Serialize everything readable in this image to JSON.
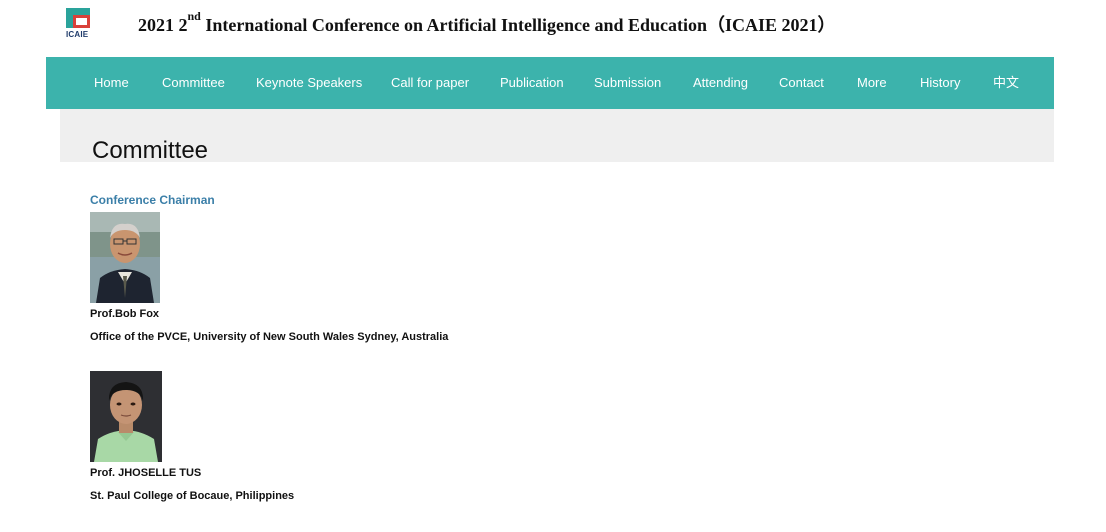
{
  "header": {
    "logo_text": "ICAIE",
    "title_prefix": "2021 2",
    "title_sup": "nd",
    "title_rest": " International Conference on Artificial Intelligence and Education（ICAIE 2021）"
  },
  "nav": {
    "items": [
      {
        "label": "Home"
      },
      {
        "label": "Committee"
      },
      {
        "label": "Keynote Speakers"
      },
      {
        "label": "Call for paper"
      },
      {
        "label": "Publication"
      },
      {
        "label": "Submission"
      },
      {
        "label": "Attending"
      },
      {
        "label": "Contact"
      },
      {
        "label": "More"
      },
      {
        "label": "History"
      },
      {
        "label": "中文"
      }
    ]
  },
  "page": {
    "title": "Committee"
  },
  "committee": {
    "section_title": "Conference Chairman",
    "members": [
      {
        "name": "Prof.Bob Fox",
        "affiliation": "Office of the PVCE, University of New South Wales Sydney, Australia"
      },
      {
        "name": "Prof. JHOSELLE TUS",
        "affiliation": "St. Paul College of Bocaue, Philippines"
      }
    ]
  },
  "colors": {
    "nav_bg": "#3cb3ac",
    "section_head": "#3b7fa8",
    "banner_bg": "#efefef"
  }
}
